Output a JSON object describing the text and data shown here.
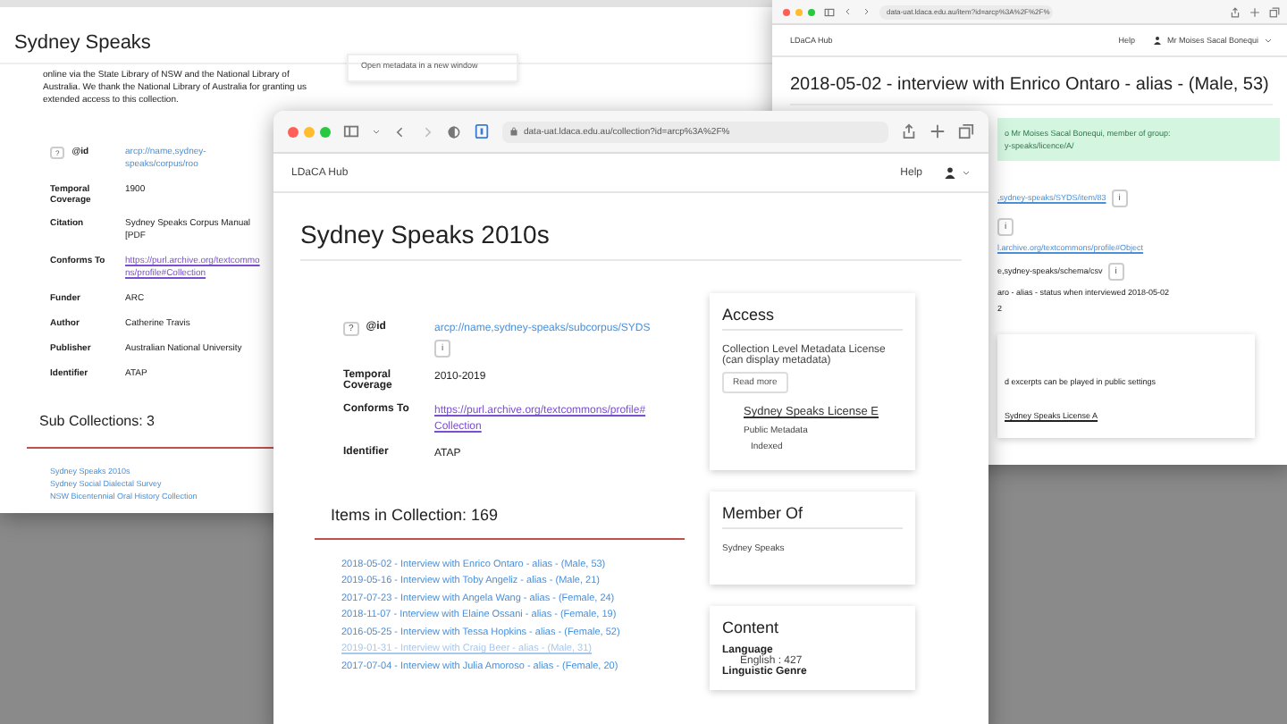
{
  "back_left_window": {
    "title": "Sydney Speaks",
    "description": "online via the State Library of NSW and the National Library of Australia. We thank the National Library of Australia for granting us extended access to this collection.",
    "side_link": "Open metadata in a new window",
    "properties": [
      {
        "kind": "id",
        "label": "@id",
        "badge": "?",
        "value": "arcp://name,sydney-speaks/corpus/roo"
      },
      {
        "kind": "text",
        "label": "Temporal Coverage",
        "value": "1900"
      },
      {
        "kind": "text",
        "label": "Citation",
        "value": "Sydney Speaks Corpus Manual [PDF"
      },
      {
        "kind": "link",
        "label": "Conforms To",
        "value": "https://purl.archive.org/textcommons/profile#Collection"
      },
      {
        "kind": "text",
        "label": "Funder",
        "value": "ARC"
      },
      {
        "kind": "text",
        "label": "Author",
        "value": "Catherine Travis"
      },
      {
        "kind": "text",
        "label": "Publisher",
        "value": "Australian National University"
      },
      {
        "kind": "text",
        "label": "Identifier",
        "value": "ATAP"
      }
    ],
    "sub_collections": {
      "heading": "Sub Collections: 3",
      "links": [
        "Sydney Speaks 2010s",
        "Sydney Social Dialectal Survey",
        "NSW Bicentennial Oral History Collection"
      ]
    }
  },
  "back_right_window": {
    "url": "data-uat.ldaca.edu.au/item?id=arcp%3A%2F%2F%",
    "brand": "LDaCA Hub",
    "help": "Help",
    "user": "Mr Moises Sacal Bonequi",
    "title": "2018-05-02 - interview with Enrico Ontaro - alias - (Male, 53)",
    "notice": [
      "o Mr Moises Sacal Bonequi, member of group:",
      "y-speaks/licence/A/"
    ],
    "fragments": [
      {
        "kind": "link",
        "text": ",sydney-speaks/SYDS/item/83",
        "info": "i"
      },
      {
        "kind": "info",
        "info": "i"
      },
      {
        "kind": "link",
        "text": "l.archive.org/textcommons/profile#Object"
      },
      {
        "kind": "text",
        "text": "e,sydney-speaks/schema/csv",
        "info": "i"
      },
      {
        "kind": "text",
        "text": "aro - alias - status when interviewed 2018-05-02"
      },
      {
        "kind": "text",
        "text": "2"
      }
    ],
    "card": {
      "text": "d excerpts can be played in public settings",
      "license": "Sydney Speaks License A"
    }
  },
  "front_window": {
    "url": "data-uat.ldaca.edu.au/collection?id=arcp%3A%2F%",
    "brand": "LDaCA Hub",
    "help": "Help",
    "title": "Sydney Speaks 2010s",
    "properties": [
      {
        "kind": "id",
        "label": "@id",
        "badge": "?",
        "value": "arcp://name,sydney-speaks/subcorpus/SYDS",
        "info": "i"
      },
      {
        "kind": "text",
        "label": "Temporal Coverage",
        "value": "2010-2019"
      },
      {
        "kind": "link",
        "label": "Conforms To",
        "value": "https://purl.archive.org/textcommons/profile#Collection"
      },
      {
        "kind": "text",
        "label": "Identifier",
        "value": "ATAP"
      }
    ],
    "items_heading": "Items in Collection: 169",
    "items": [
      {
        "text": "2018-05-02 - Interview with Enrico Ontaro - alias - (Male, 53)",
        "hovered": false
      },
      {
        "text": "2019-05-16 - Interview with Toby Angeliz - alias - (Male, 21)",
        "hovered": false
      },
      {
        "text": "2017-07-23 - Interview with Angela Wang - alias - (Female, 24)",
        "hovered": false
      },
      {
        "text": "2018-11-07 - Interview with Elaine Ossani - alias - (Female, 19)",
        "hovered": false
      },
      {
        "text": "2016-05-25 - Interview with Tessa Hopkins - alias - (Female, 52)",
        "hovered": false
      },
      {
        "text": "2019-01-31 - Interview with Craig Beer - alias - (Male, 31)",
        "hovered": true
      },
      {
        "text": "2017-07-04 - Interview with Julia Amoroso - alias - (Female, 20)",
        "hovered": false
      }
    ],
    "access": {
      "heading": "Access",
      "license_text": "Collection Level Metadata License (can display metadata)",
      "button": "Read more",
      "license_link": "Sydney Speaks License E",
      "tags": [
        "Public Metadata",
        "Indexed"
      ]
    },
    "member_of": {
      "heading": "Member Of",
      "items": [
        "Sydney Speaks"
      ]
    },
    "content": {
      "heading": "Content",
      "fields": [
        {
          "label": "Language",
          "values": [
            "English : 427"
          ]
        },
        {
          "label": "Linguistic Genre"
        }
      ]
    }
  }
}
